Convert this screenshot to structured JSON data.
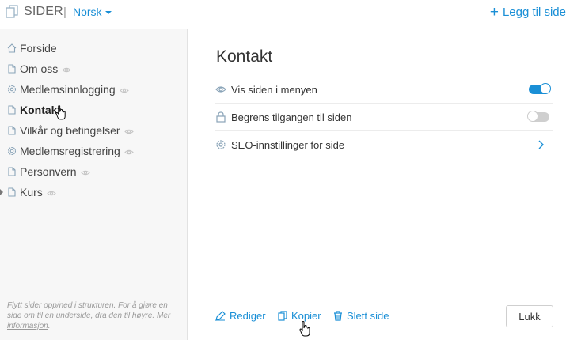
{
  "header": {
    "app_title": "SIDER",
    "separator": "|",
    "language": "Norsk",
    "add_page": "Legg til side"
  },
  "sidebar": {
    "items": [
      {
        "label": "Forside",
        "icon": "home-icon",
        "eye": false,
        "active": false
      },
      {
        "label": "Om oss",
        "icon": "page-icon",
        "eye": true,
        "active": false
      },
      {
        "label": "Medlemsinnlogging",
        "icon": "gear-icon",
        "eye": true,
        "active": false
      },
      {
        "label": "Kontakt",
        "icon": "page-icon",
        "eye": false,
        "active": true
      },
      {
        "label": "Vilkår og betingelser",
        "icon": "page-icon",
        "eye": true,
        "active": false
      },
      {
        "label": "Medlemsregistrering",
        "icon": "gear-icon",
        "eye": true,
        "active": false
      },
      {
        "label": "Personvern",
        "icon": "page-icon",
        "eye": true,
        "active": false
      },
      {
        "label": "Kurs",
        "icon": "page-icon",
        "eye": true,
        "active": false
      }
    ],
    "hint_text": "Flytt sider opp/ned i strukturen. For å gjøre en side om til en underside, dra den til høyre.",
    "hint_link": "Mer informasjon"
  },
  "main": {
    "title": "Kontakt",
    "settings": [
      {
        "label": "Vis siden i menyen",
        "icon": "eye-icon",
        "control": "toggle",
        "on": true
      },
      {
        "label": "Begrens tilgangen til siden",
        "icon": "lock-icon",
        "control": "toggle",
        "on": false
      },
      {
        "label": "SEO-innstillinger for side",
        "icon": "gear-icon",
        "control": "chevron"
      }
    ],
    "actions": {
      "edit": "Rediger",
      "copy": "Kopier",
      "delete": "Slett side"
    },
    "close": "Lukk"
  },
  "colors": {
    "accent": "#1a8fd6",
    "sidebar_bg": "#f7f7f7",
    "icon_gray": "#8aa4b8"
  }
}
